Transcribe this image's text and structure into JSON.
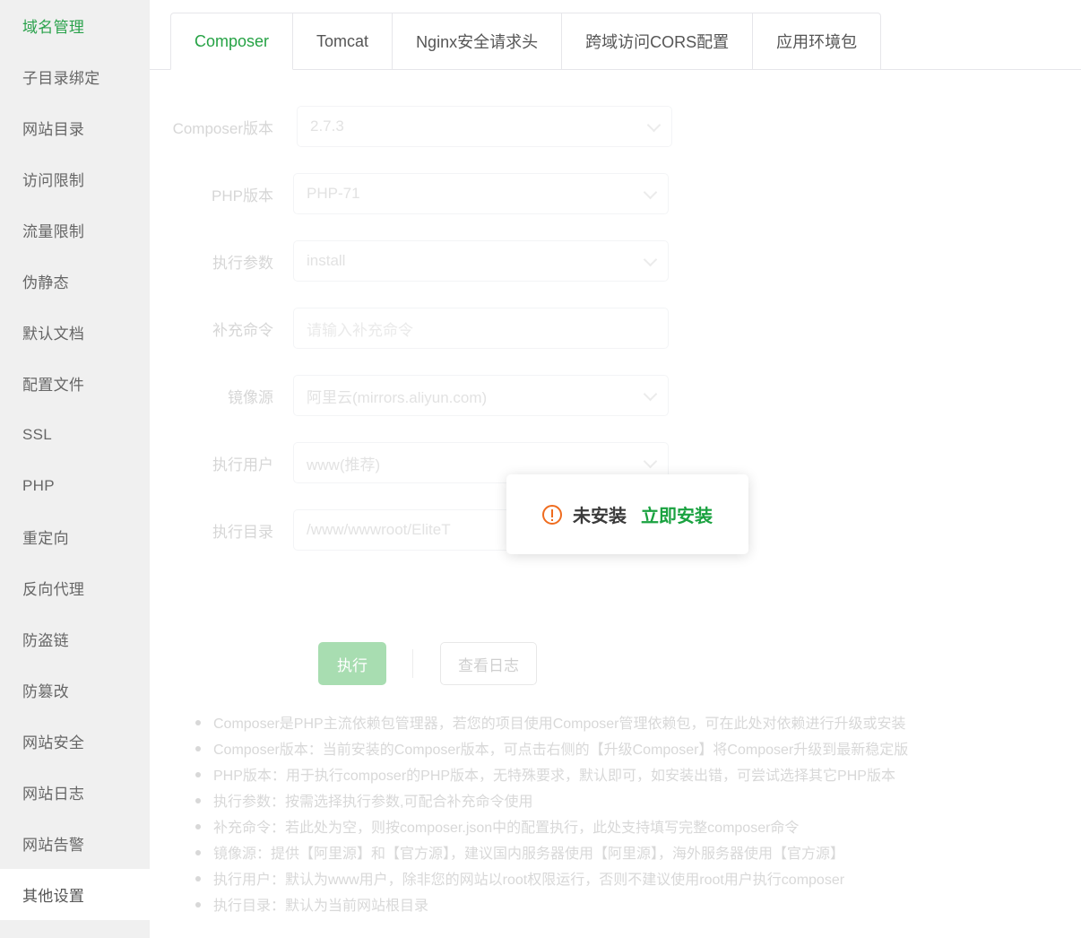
{
  "sidebar": {
    "items": [
      {
        "label": "域名管理",
        "state": "green"
      },
      {
        "label": "子目录绑定",
        "state": "normal"
      },
      {
        "label": "网站目录",
        "state": "normal"
      },
      {
        "label": "访问限制",
        "state": "normal"
      },
      {
        "label": "流量限制",
        "state": "normal"
      },
      {
        "label": "伪静态",
        "state": "normal"
      },
      {
        "label": "默认文档",
        "state": "normal"
      },
      {
        "label": "配置文件",
        "state": "normal"
      },
      {
        "label": "SSL",
        "state": "normal"
      },
      {
        "label": "PHP",
        "state": "normal"
      },
      {
        "label": "重定向",
        "state": "normal"
      },
      {
        "label": "反向代理",
        "state": "normal"
      },
      {
        "label": "防盗链",
        "state": "normal"
      },
      {
        "label": "防篡改",
        "state": "normal"
      },
      {
        "label": "网站安全",
        "state": "normal"
      },
      {
        "label": "网站日志",
        "state": "normal"
      },
      {
        "label": "网站告警",
        "state": "normal"
      },
      {
        "label": "其他设置",
        "state": "selected"
      }
    ]
  },
  "tabs": [
    {
      "label": "Composer",
      "active": true
    },
    {
      "label": "Tomcat",
      "active": false
    },
    {
      "label": "Nginx安全请求头",
      "active": false
    },
    {
      "label": "跨域访问CORS配置",
      "active": false
    },
    {
      "label": "应用环境包",
      "active": false
    }
  ],
  "form": {
    "fields": [
      {
        "label": "Composer版本",
        "value": "2.7.3",
        "type": "select",
        "placeholder": ""
      },
      {
        "label": "PHP版本",
        "value": "PHP-71",
        "type": "select",
        "placeholder": ""
      },
      {
        "label": "执行参数",
        "value": "install",
        "type": "select",
        "placeholder": ""
      },
      {
        "label": "补充命令",
        "value": "",
        "type": "text",
        "placeholder": "请输入补充命令"
      },
      {
        "label": "镜像源",
        "value": "阿里云(mirrors.aliyun.com)",
        "type": "select",
        "placeholder": ""
      },
      {
        "label": "执行用户",
        "value": "www(推荐)",
        "type": "select",
        "placeholder": ""
      },
      {
        "label": "执行目录",
        "value": "/www/wwwroot/EliteT",
        "type": "text",
        "placeholder": ""
      }
    ]
  },
  "actions": {
    "execute_label": "执行",
    "view_log_label": "查看日志"
  },
  "popup": {
    "icon": "warning-circle-icon",
    "status_text": "未安装",
    "action_text": "立即安装"
  },
  "help": {
    "items": [
      "Composer是PHP主流依赖包管理器，若您的项目使用Composer管理依赖包，可在此处对依赖进行升级或安装",
      "Composer版本：当前安装的Composer版本，可点击右侧的【升级Composer】将Composer升级到最新稳定版",
      "PHP版本：用于执行composer的PHP版本，无特殊要求，默认即可，如安装出错，可尝试选择其它PHP版本",
      "执行参数：按需选择执行参数,可配合补充命令使用",
      "补充命令：若此处为空，则按composer.json中的配置执行，此处支持填写完整composer命令",
      "镜像源：提供【阿里源】和【官方源】，建议国内服务器使用【阿里源】，海外服务器使用【官方源】",
      "执行用户：默认为www用户，除非您的网站以root权限运行，否则不建议使用root用户执行composer",
      "执行目录：默认为当前网站根目录"
    ]
  },
  "colors": {
    "accent_green": "#25a244",
    "warning_orange": "#ef6c1f",
    "sidebar_bg": "#f0f0f0"
  }
}
